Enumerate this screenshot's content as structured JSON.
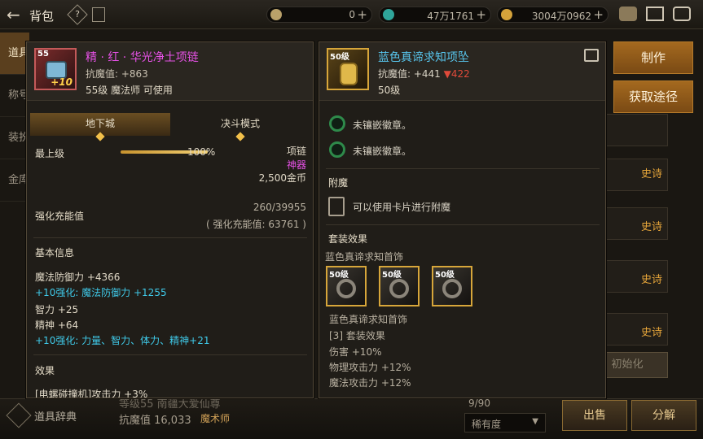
{
  "topbar": {
    "title": "背包",
    "help_symbol": "?",
    "currencies": [
      {
        "icon": "gold-coin-icon",
        "value": "0",
        "color": "#b9a16a"
      },
      {
        "icon": "green-gem-icon",
        "value": "47万1761",
        "color": "#2fa59a"
      },
      {
        "icon": "gold-medal-icon",
        "value": "3004万0962",
        "color": "#d4a23a"
      }
    ],
    "plus_symbol": "+"
  },
  "left_tabs": [
    "道具",
    "称号",
    "装扮",
    "金库"
  ],
  "background": {
    "tags": [
      "史诗",
      "史诗",
      "史诗",
      "史诗",
      "史诗"
    ],
    "resist": "抗魔值 16,033",
    "class_label": "魔术师",
    "footer_partial": "等级55 南疆大爱仙尊",
    "count": "9/90",
    "rarity_select": "稀有度",
    "sell_button": "出售",
    "decompose_button": "分解",
    "init_button": "初始化",
    "dict_label": "道具辞典"
  },
  "left_item": {
    "name": "精 · 红 · 华光净土项链",
    "name_color": "#e651e6",
    "icon_level": "55",
    "icon_enhance": "+10",
    "resist_label": "抗魔值: +863",
    "usable": "55级 魔法师 可使用",
    "mode_tabs": [
      "地下城",
      "决斗模式"
    ],
    "top_level_label": "最上级",
    "top_level_percent": 100,
    "top_level_text": "100%",
    "slot_type": "项链",
    "grade": "神器",
    "price": "2,500金币",
    "charge_label": "强化充能值",
    "charge_value": "260/39955",
    "charge_sub": "( 强化充能值: 63761 )",
    "basic_info_title": "基本信息",
    "stats": [
      {
        "text": "魔法防御力 +4366",
        "type": "normal"
      },
      {
        "text": "+10强化: 魔法防御力 +1255",
        "type": "blue"
      },
      {
        "text": "智力 +25",
        "type": "normal"
      },
      {
        "text": "精神 +64",
        "type": "normal"
      },
      {
        "text": "+10强化: 力量、智力、体力、精神+21",
        "type": "blue"
      }
    ],
    "effect_title": "效果",
    "effect_partial": "[电螺碰撞机]攻击力 +3%"
  },
  "right_item": {
    "name": "蓝色真谛求知项坠",
    "name_color": "#58c6ee",
    "icon_level": "50级",
    "resist_label": "抗魔值: +441",
    "resist_diff": "▼422",
    "level_text": "50级",
    "sockets": [
      "未镶嵌徽章。",
      "未镶嵌徽章。"
    ],
    "enchant_title": "附魔",
    "enchant_text": "可以使用卡片进行附魔",
    "set_title": "套装效果",
    "set_name": "蓝色真谛求知首饰",
    "set_pieces": [
      "50级",
      "50级",
      "50级"
    ],
    "set_lines": [
      "蓝色真谛求知首饰",
      "[3] 套装效果",
      "伤害 +10%",
      "物理攻击力 +12%",
      "魔法攻击力 +12%"
    ]
  },
  "side_buttons": {
    "craft": "制作",
    "obtain": "获取途径"
  }
}
